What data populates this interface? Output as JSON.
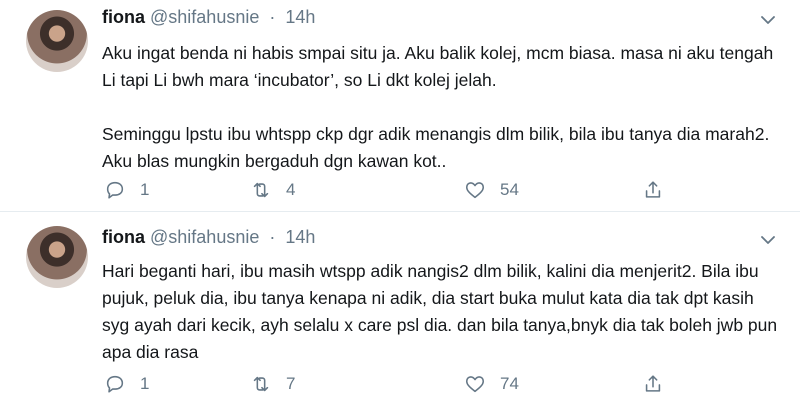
{
  "tweets": [
    {
      "name": "fiona",
      "handle": "@shifahusnie",
      "separator": "·",
      "time": "14h",
      "paragraphs": [
        "Aku ingat benda ni habis smpai situ ja. Aku balik kolej, mcm biasa. masa ni aku tengah Li tapi Li bwh mara ‘incubator’, so Li dkt kolej jelah.",
        "Seminggu lpstu ibu whtspp ckp dgr adik menangis dlm bilik, bila ibu tanya dia marah2. Aku blas mungkin bergaduh dgn kawan kot.."
      ],
      "replies": "1",
      "retweets": "4",
      "likes": "54"
    },
    {
      "name": "fiona",
      "handle": "@shifahusnie",
      "separator": "·",
      "time": "14h",
      "paragraphs": [
        "Hari beganti hari, ibu masih wtspp adik nangis2 dlm bilik, kalini dia menjerit2. Bila ibu pujuk, peluk dia, ibu tanya kenapa ni adik, dia start buka mulut kata dia tak dpt kasih syg ayah dari kecik, ayh selalu x care psl dia. dan bila tanya,bnyk dia tak boleh jwb pun apa dia rasa"
      ],
      "replies": "1",
      "retweets": "7",
      "likes": "74"
    }
  ],
  "icons": {
    "reply": "reply-icon",
    "retweet": "retweet-icon",
    "like": "heart-icon",
    "share": "share-icon",
    "more": "chevron-down-icon"
  },
  "colors": {
    "text": "#14171a",
    "secondary": "#657786",
    "divider": "#e6ecf0"
  }
}
